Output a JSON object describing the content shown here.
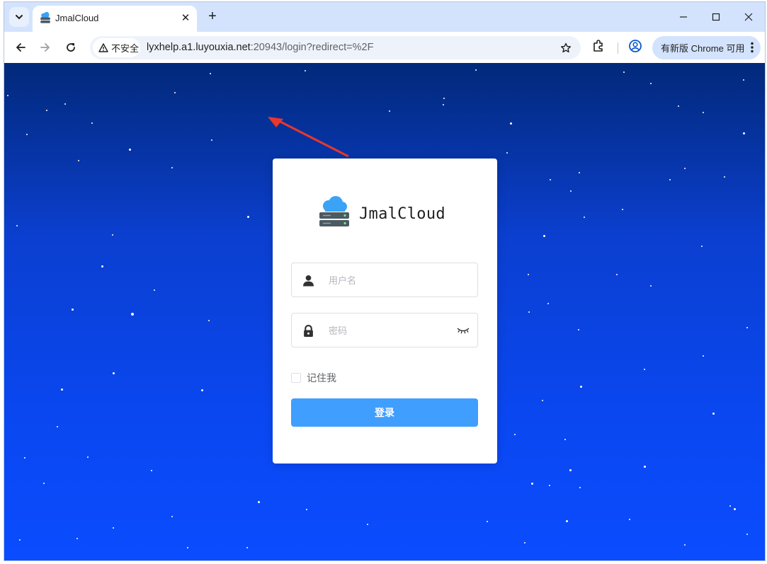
{
  "browser": {
    "tab": {
      "title": "JmalCloud",
      "close_glyph": "✕"
    },
    "new_tab_glyph": "+",
    "window_controls": {
      "minimize": "—",
      "maximize": "☐",
      "close": "✕"
    },
    "omnibox": {
      "security_label": "不安全",
      "url_host": "lyxhelp.a1.luyouxia.net",
      "url_rest": ":20943/login?redirect=%2F"
    },
    "update_button_label": "有新版 Chrome 可用",
    "icons": [
      "tab-search-icon",
      "back-arrow-icon",
      "forward-arrow-icon",
      "reload-icon",
      "warning-icon",
      "star-icon",
      "extensions-icon",
      "profile-icon",
      "menu-icon"
    ]
  },
  "login": {
    "brand": "JmalCloud",
    "username_placeholder": "用户名",
    "password_placeholder": "密码",
    "remember_label": "记住我",
    "remember_checked": false,
    "submit_label": "登录"
  },
  "colors": {
    "primary": "#409eff",
    "background_top": "#02297a",
    "background_bottom": "#0a4cff",
    "annotation_arrow": "#e8372c"
  }
}
